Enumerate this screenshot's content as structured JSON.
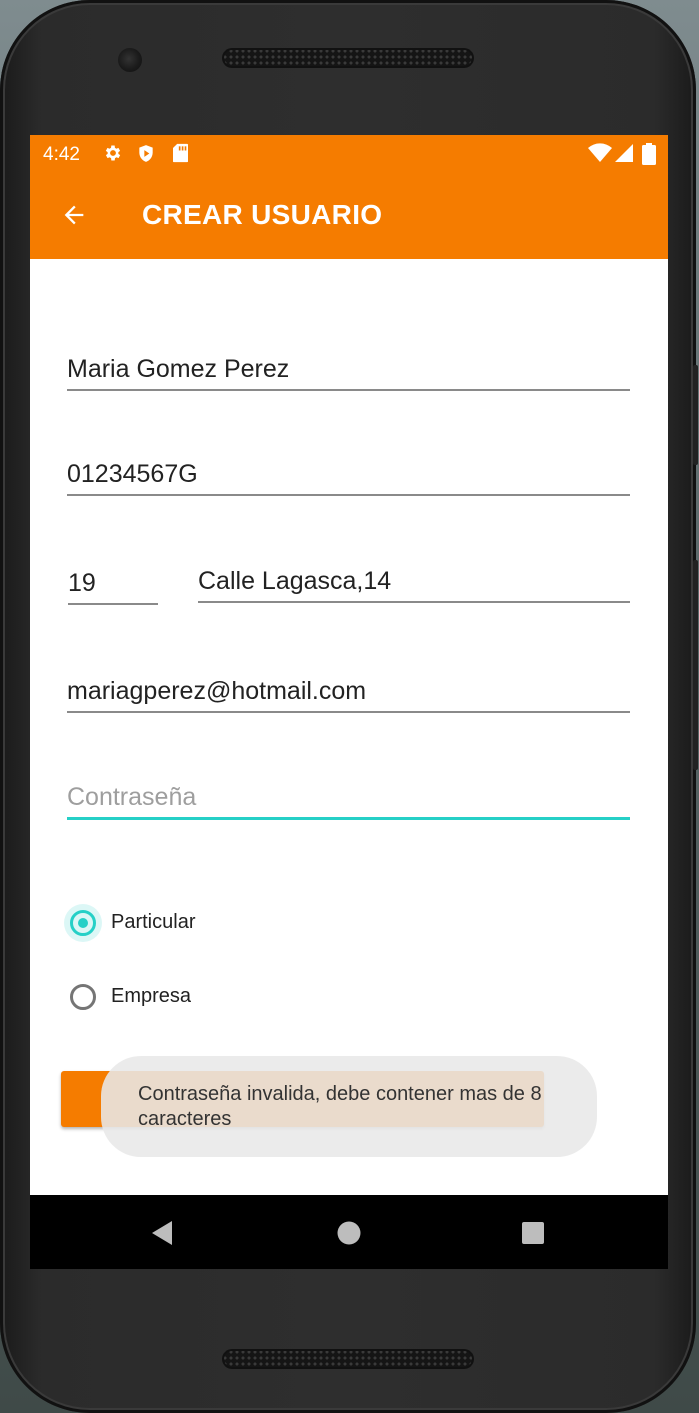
{
  "status_bar": {
    "time": "4:42",
    "icons": [
      "settings-icon",
      "play-shield-icon",
      "sd-card-icon",
      "wifi-icon",
      "signal-icon",
      "battery-icon"
    ]
  },
  "app_bar": {
    "title": "CREAR USUARIO",
    "back_icon": "arrow-back-icon"
  },
  "form": {
    "full_name": "Maria Gomez Perez",
    "dni": "01234567G",
    "age": "19",
    "address": "Calle Lagasca,14",
    "email": "mariagperez@hotmail.com",
    "password_placeholder": "Contraseña",
    "account_type": {
      "options": [
        {
          "label": "Particular",
          "selected": true
        },
        {
          "label": "Empresa",
          "selected": false
        }
      ]
    }
  },
  "toast": {
    "message": "Contraseña invalida, debe contener mas de 8 caracteres"
  },
  "nav_bar": {
    "icons": [
      "back-triangle-icon",
      "home-circle-icon",
      "recents-square-icon"
    ]
  },
  "colors": {
    "primary": "#F57C00",
    "accent": "#26D0C7",
    "text": "#222222",
    "hint": "#9E9E9E"
  }
}
